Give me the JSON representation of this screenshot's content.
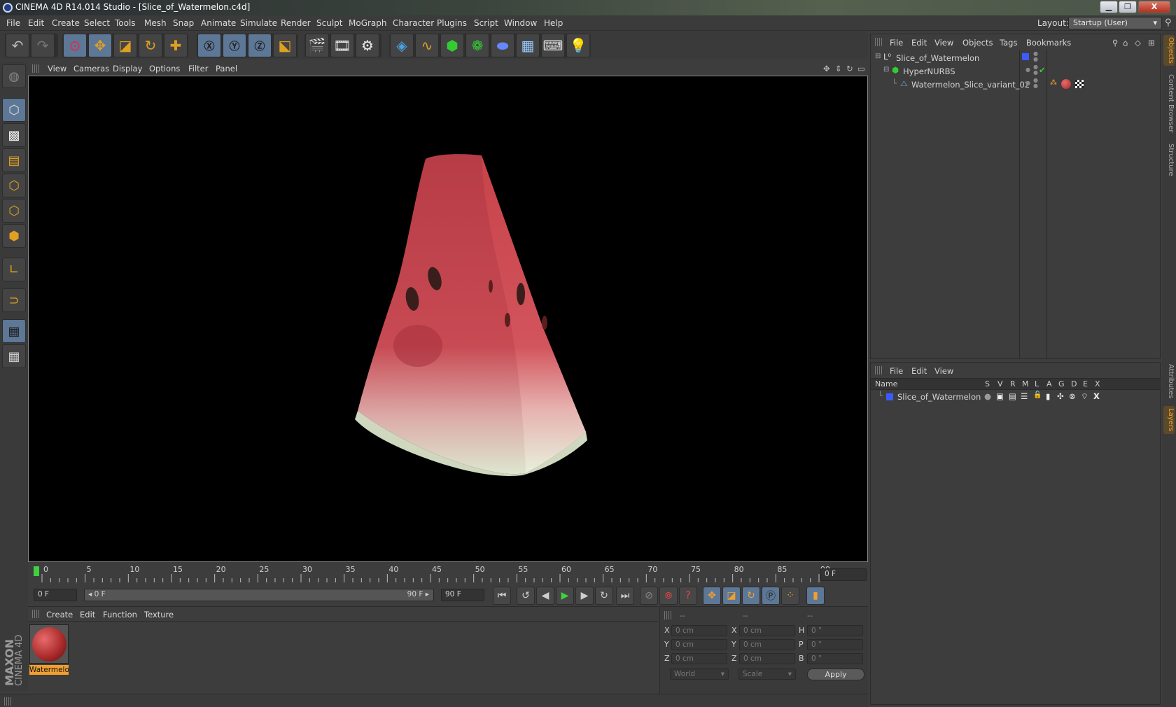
{
  "window": {
    "title": "CINEMA 4D R14.014 Studio - [Slice_of_Watermelon.c4d]",
    "minimize": "▁",
    "restore": "❐",
    "close": "X"
  },
  "menubar": {
    "items": [
      "File",
      "Edit",
      "Create",
      "Select",
      "Tools",
      "Mesh",
      "Snap",
      "Animate",
      "Simulate",
      "Render",
      "Sculpt",
      "MoGraph",
      "Character",
      "Plugins",
      "Script",
      "Window",
      "Help"
    ],
    "layout_label": "Layout:",
    "layout_value": "Startup (User)"
  },
  "toolbar": {
    "icons": [
      "undo-icon",
      "redo-icon",
      "live-selection-icon",
      "move-icon",
      "scale-icon",
      "rotate-icon",
      "add-icon",
      "x-axis-icon",
      "y-axis-icon",
      "z-axis-icon",
      "world-coords-icon",
      "render-view-icon",
      "render-picture-viewer-icon",
      "edit-render-settings-icon",
      "cube-icon",
      "spline-pen-icon",
      "subdivision-surface-icon",
      "array-icon",
      "deformer-icon",
      "floor-icon",
      "camera-icon",
      "light-icon"
    ]
  },
  "viewport": {
    "menu": [
      "View",
      "Cameras",
      "Display",
      "Options",
      "Filter",
      "Panel"
    ],
    "model_name": "Slice_of_Watermelon"
  },
  "timeline": {
    "ticks": [
      "0",
      "5",
      "10",
      "15",
      "20",
      "25",
      "30",
      "35",
      "40",
      "45",
      "50",
      "55",
      "60",
      "65",
      "70",
      "75",
      "80",
      "85",
      "90"
    ],
    "current_frame": "0 F"
  },
  "transport": {
    "start_field": "0 F",
    "range_start": "◂ 0 F",
    "range_end": "90 F ▸",
    "end_field": "90 F"
  },
  "material_manager": {
    "menu": [
      "Create",
      "Edit",
      "Function",
      "Texture"
    ],
    "materials": [
      {
        "name": "Watermelo"
      }
    ]
  },
  "coordinates": {
    "headers": [
      "--",
      "--",
      "--"
    ],
    "rows": [
      {
        "pos_label": "X",
        "pos": "0 cm",
        "size_label": "X",
        "size": "0 cm",
        "rot_label": "H",
        "rot": "0 °"
      },
      {
        "pos_label": "Y",
        "pos": "0 cm",
        "size_label": "Y",
        "size": "0 cm",
        "rot_label": "P",
        "rot": "0 °"
      },
      {
        "pos_label": "Z",
        "pos": "0 cm",
        "size_label": "Z",
        "size": "0 cm",
        "rot_label": "B",
        "rot": "0 °"
      }
    ],
    "coord_mode": "World",
    "size_mode": "Scale",
    "apply": "Apply"
  },
  "object_manager": {
    "menu": [
      "File",
      "Edit",
      "View",
      "Objects",
      "Tags",
      "Bookmarks"
    ],
    "objects": [
      {
        "name": "Slice_of_Watermelon",
        "indent": 0
      },
      {
        "name": "HyperNURBS",
        "indent": 1
      },
      {
        "name": "Watermelon_Slice_variant_02",
        "indent": 2
      }
    ]
  },
  "layer_manager": {
    "menu": [
      "File",
      "Edit",
      "View"
    ],
    "columns": [
      "Name",
      "S",
      "V",
      "R",
      "M",
      "L",
      "A",
      "G",
      "D",
      "E",
      "X"
    ],
    "layers": [
      {
        "name": "Slice_of_Watermelon",
        "color": "#3a5cff"
      }
    ]
  },
  "right_tabs": [
    "Objects",
    "Content Browser",
    "Structure",
    "Attributes",
    "Layers"
  ],
  "branding": {
    "maxon": "MAXON",
    "product": "CINEMA 4D"
  },
  "colors": {
    "accent": "#f0a030",
    "selection": "#5d7796",
    "play": "#3fd13f"
  }
}
